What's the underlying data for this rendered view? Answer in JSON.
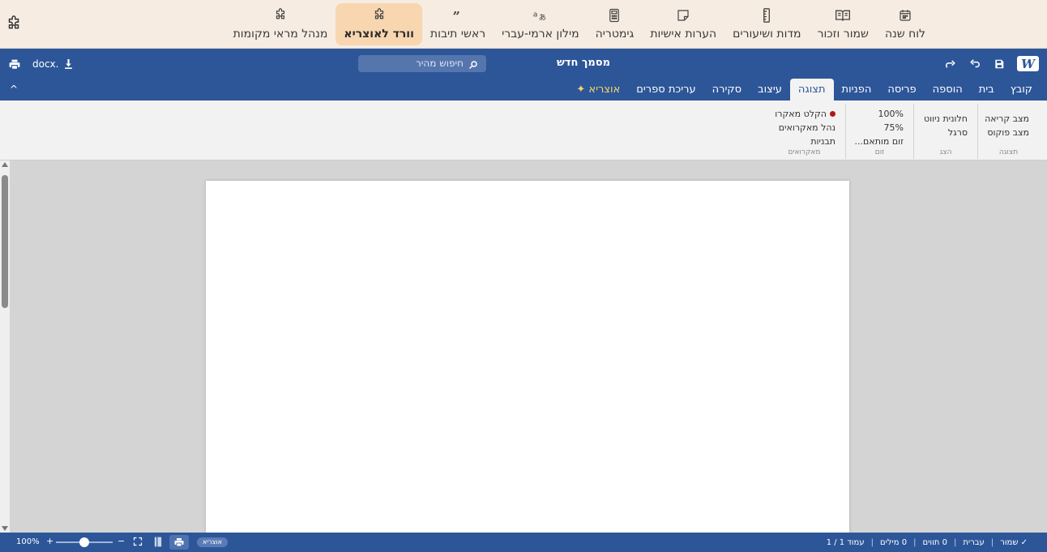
{
  "topbar": {
    "tools": [
      {
        "label": "לוח שנה",
        "icon": "calendar-icon"
      },
      {
        "label": "שמור וזכור",
        "icon": "open-book-icon"
      },
      {
        "label": "מדות ושיעורים",
        "icon": "ruler-icon"
      },
      {
        "label": "הערות אישיות",
        "icon": "sticky-note-icon"
      },
      {
        "label": "גימטריה",
        "icon": "calculator-icon"
      },
      {
        "label": "מילון ארמי-עברי",
        "icon": "translate-icon"
      },
      {
        "label": "ראשי תיבות",
        "icon": "quote-icon"
      },
      {
        "label": "וורד לאוצריא",
        "icon": "puzzle-icon",
        "active": true
      },
      {
        "label": "מנהל מראי מקומות",
        "icon": "puzzle-icon"
      }
    ]
  },
  "header": {
    "logo": "W",
    "title": "מסמך חדש",
    "search_placeholder": "חיפוש מהיר",
    "export_label": "docx.",
    "collapse_label": "^"
  },
  "tabs": [
    "קובץ",
    "בית",
    "הוספה",
    "פריסה",
    "הפניות",
    "תצוגה",
    "עיצוב",
    "סקירה",
    "עריכת ספרים",
    "✦ אוצריא"
  ],
  "active_tab": "תצוגה",
  "ribbon": {
    "groups": [
      {
        "name": "תצוגה",
        "items": [
          "מצב קריאה",
          "מצב פוקוס"
        ]
      },
      {
        "name": "הצג",
        "items": [
          "חלונית ניווט",
          "סרגל"
        ]
      },
      {
        "name": "זום",
        "items": [
          "100%",
          "75%",
          "זום מותאם..."
        ]
      },
      {
        "name": "מאקרואים",
        "items": [
          "הקלט מאקרו",
          "נהל מאקרואים",
          "תבניות"
        ]
      }
    ]
  },
  "statusbar": {
    "page": "עמוד 1 / 1",
    "words": "0 מילים",
    "chars": "0 תווים",
    "language": "עברית",
    "saved": "✓ שמור",
    "ozar_badge": "אוצריא",
    "zoom": "100%",
    "zoom_in": "+",
    "zoom_out": "−",
    "zoom_level": 0.5
  },
  "colors": {
    "accent_blue": "#2d5699",
    "topbar_bg": "#f6ece2",
    "active_tool_bg": "#f7d6b0",
    "record_red": "#b31616"
  }
}
